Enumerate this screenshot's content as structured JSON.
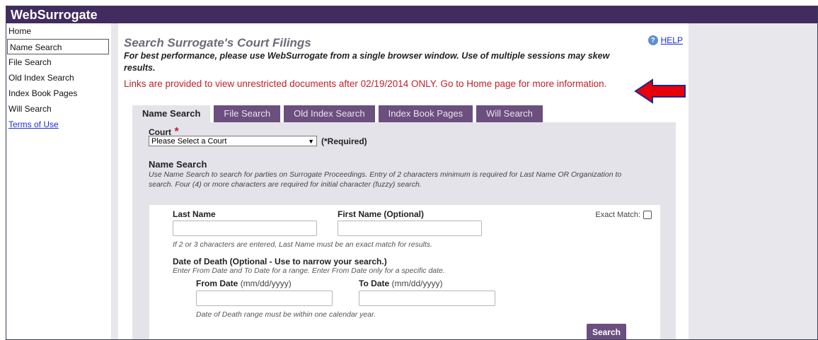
{
  "app": {
    "title": "WebSurrogate"
  },
  "sidebar": {
    "items": [
      {
        "label": "Home"
      },
      {
        "label": "Name Search"
      },
      {
        "label": "File Search"
      },
      {
        "label": "Old Index Search"
      },
      {
        "label": "Index Book Pages"
      },
      {
        "label": "Will Search"
      },
      {
        "label": "Terms of Use"
      }
    ]
  },
  "main": {
    "title": "Search Surrogate's Court Filings",
    "help_label": "HELP",
    "performance_note": "For best performance, please use WebSurrogate from a single browser window. Use of multiple sessions may skew results.",
    "links_notice": "Links are provided to view unrestricted documents after 02/19/2014 ONLY. Go to Home page for more information.",
    "tabs": [
      {
        "label": "Name Search"
      },
      {
        "label": "File Search"
      },
      {
        "label": "Old Index Search"
      },
      {
        "label": "Index Book Pages"
      },
      {
        "label": "Will Search"
      }
    ],
    "court": {
      "label": "Court",
      "required_mark": "*",
      "selected": "Please Select a Court",
      "required_text": "(*Required)"
    },
    "name_search": {
      "heading": "Name Search",
      "description": "Use Name Search to search for parties on Surrogate Proceedings. Entry of 2 characters minimum is required for Last Name OR Organization to search. Four (4) or more characters are required for initial character (fuzzy) search.",
      "last_name_label": "Last Name",
      "first_name_label": "First Name (Optional)",
      "exact_match_label": "Exact Match:",
      "last_name_hint": "If 2 or 3 characters are entered, Last Name must be an exact match for results.",
      "dod_heading": "Date of Death (Optional - Use to narrow your search.)",
      "dod_desc": "Enter From Date and To Date for a range. Enter From Date only for a specific date.",
      "from_date_label": "From Date",
      "to_date_label": "To Date",
      "date_format": "(mm/dd/yyyy)",
      "dod_hint": "Date of Death range must be within one calendar year.",
      "search_button": "Search"
    }
  },
  "colors": {
    "header_bg": "#412b5f",
    "tab_bg": "#6b4f7e",
    "panel_bg": "#e4e3ea",
    "notice_red": "#c0222c",
    "arrow_red": "#e8000b",
    "link_blue": "#1a2fd0"
  },
  "icons": {
    "help": "help-circle-icon",
    "arrow": "red-left-arrow-icon"
  }
}
